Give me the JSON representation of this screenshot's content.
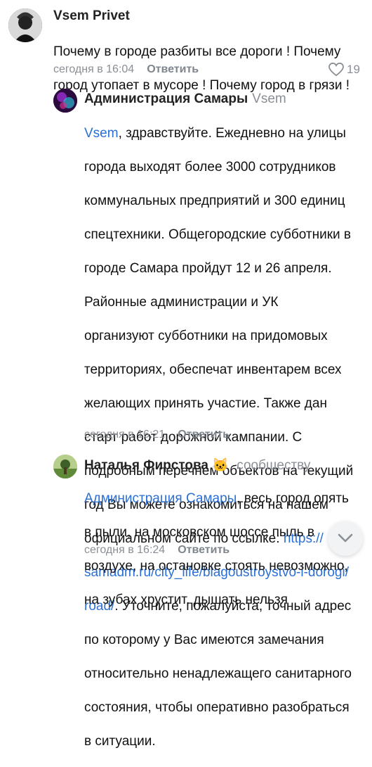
{
  "comments": [
    {
      "author": "Vsem Privet",
      "text_lines": [
        "Почему в городе разбиты все дороги ! Почему",
        "город утопает в мусоре ! Почему город в грязи !"
      ],
      "time": "сегодня в 16:04",
      "reply_label": "Ответить",
      "likes": "19"
    },
    {
      "author": "Администрация Самары",
      "reply_to": "Vsem",
      "mention": "Vsem",
      "text_lines": [
        ", здравствуйте. Ежедневно на улицы",
        "города выходят более 3000 сотрудников",
        "коммунальных предприятий и 300 единиц",
        "спецтехники. Общегородские субботники в",
        "городе Самара пройдут 12 и 26 апреля.",
        "Районные администрации и УК",
        "организуют субботники на придомовых",
        "территориях, обеспечат инвентарем всех",
        "желающих принять участие. Также дан",
        "старт работ дорожной кампании. С",
        "подробным перечнем объектов на текущий",
        "год Вы можете ознакомиться на нашем",
        "официальном сайте по ссылке: "
      ],
      "link_part1": "https://",
      "link_part2": "samadm.ru/city_life/blagoustroystvo-i-dorogi/",
      "link_part3": "road/",
      "text_after_link": ". Уточните, пожалуйста, точный адрес",
      "text_lines_end": [
        "по которому у Вас имеются замечания",
        "относительно ненадлежащего санитарного",
        "состояния, чтобы оперативно разобраться",
        "в ситуации."
      ],
      "time": "сегодня в 16:21",
      "reply_label": "Ответить"
    },
    {
      "author": "Наталья Фирстова",
      "badge_emoji": "🐱",
      "reply_to": "сообществу",
      "mention": "Администрация Самары",
      "first_line_rest": ", весь город опять",
      "text_lines": [
        "в пыли, на московском шоссе пыль в",
        "воздухе, на остановке стоять невозможно,",
        "на зубах хрустит, дышать нельзя"
      ],
      "time": "сегодня в 16:24",
      "reply_label": "Ответить"
    }
  ],
  "colors": {
    "link": "#2a6fd6",
    "meta": "#8a8f96"
  },
  "icons": {
    "like": "heart-icon",
    "scroll": "chevron-down-icon"
  }
}
